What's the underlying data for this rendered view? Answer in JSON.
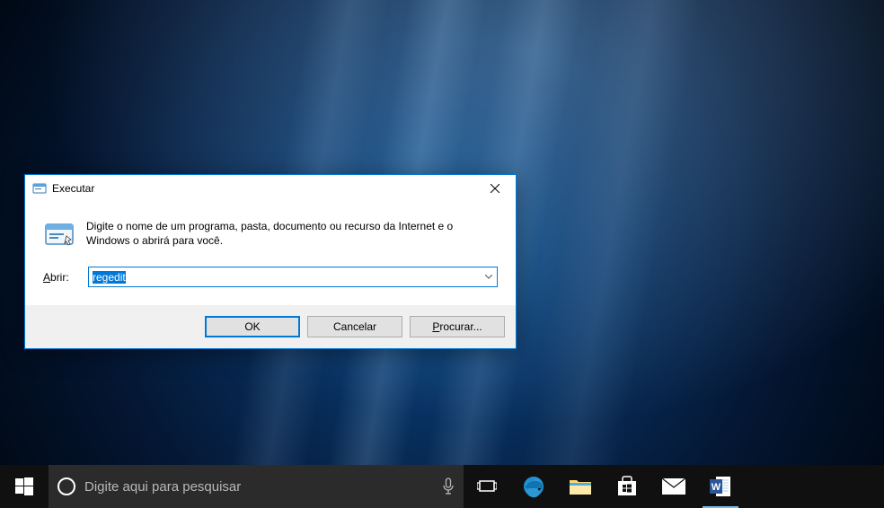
{
  "dialog": {
    "title": "Executar",
    "prompt": "Digite o nome de um programa, pasta, documento ou recurso da Internet e o Windows o abrirá para você.",
    "open_label": "Abrir:",
    "open_underline": "A",
    "input_value": "regedit",
    "buttons": {
      "ok": "OK",
      "cancel": "Cancelar",
      "browse": "Procurar...",
      "browse_underline": "P"
    }
  },
  "taskbar": {
    "search_placeholder": "Digite aqui para pesquisar"
  }
}
